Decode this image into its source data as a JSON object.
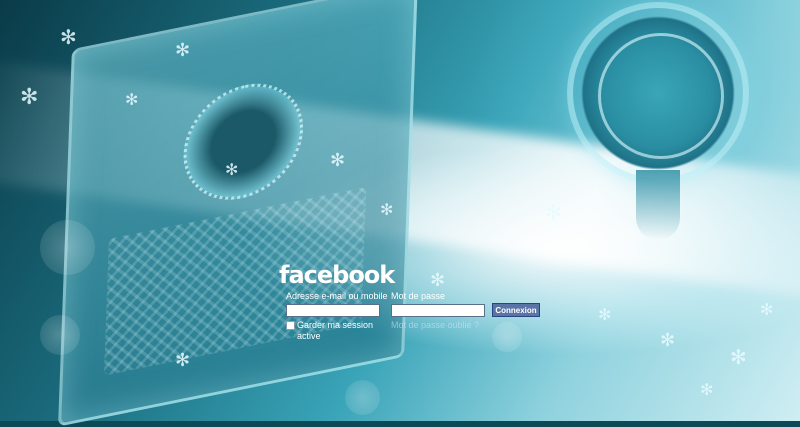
{
  "brand": {
    "logo_text": "facebook"
  },
  "login": {
    "email_label": "Adresse e-mail ou mobile",
    "email_value": "",
    "password_label": "Mot de passe",
    "password_value": "",
    "submit_label": "Connexion",
    "remember_label": "Garder ma session active",
    "forgot_label": "Mot de passe oublié ?"
  },
  "colors": {
    "button_bg": "#5b74a8",
    "button_border": "#29447e",
    "label_text": "#ffffff",
    "background_dark": "#0a3b48",
    "background_light": "#cfeef3"
  },
  "icons": {
    "decorative_star": "star-icon"
  }
}
